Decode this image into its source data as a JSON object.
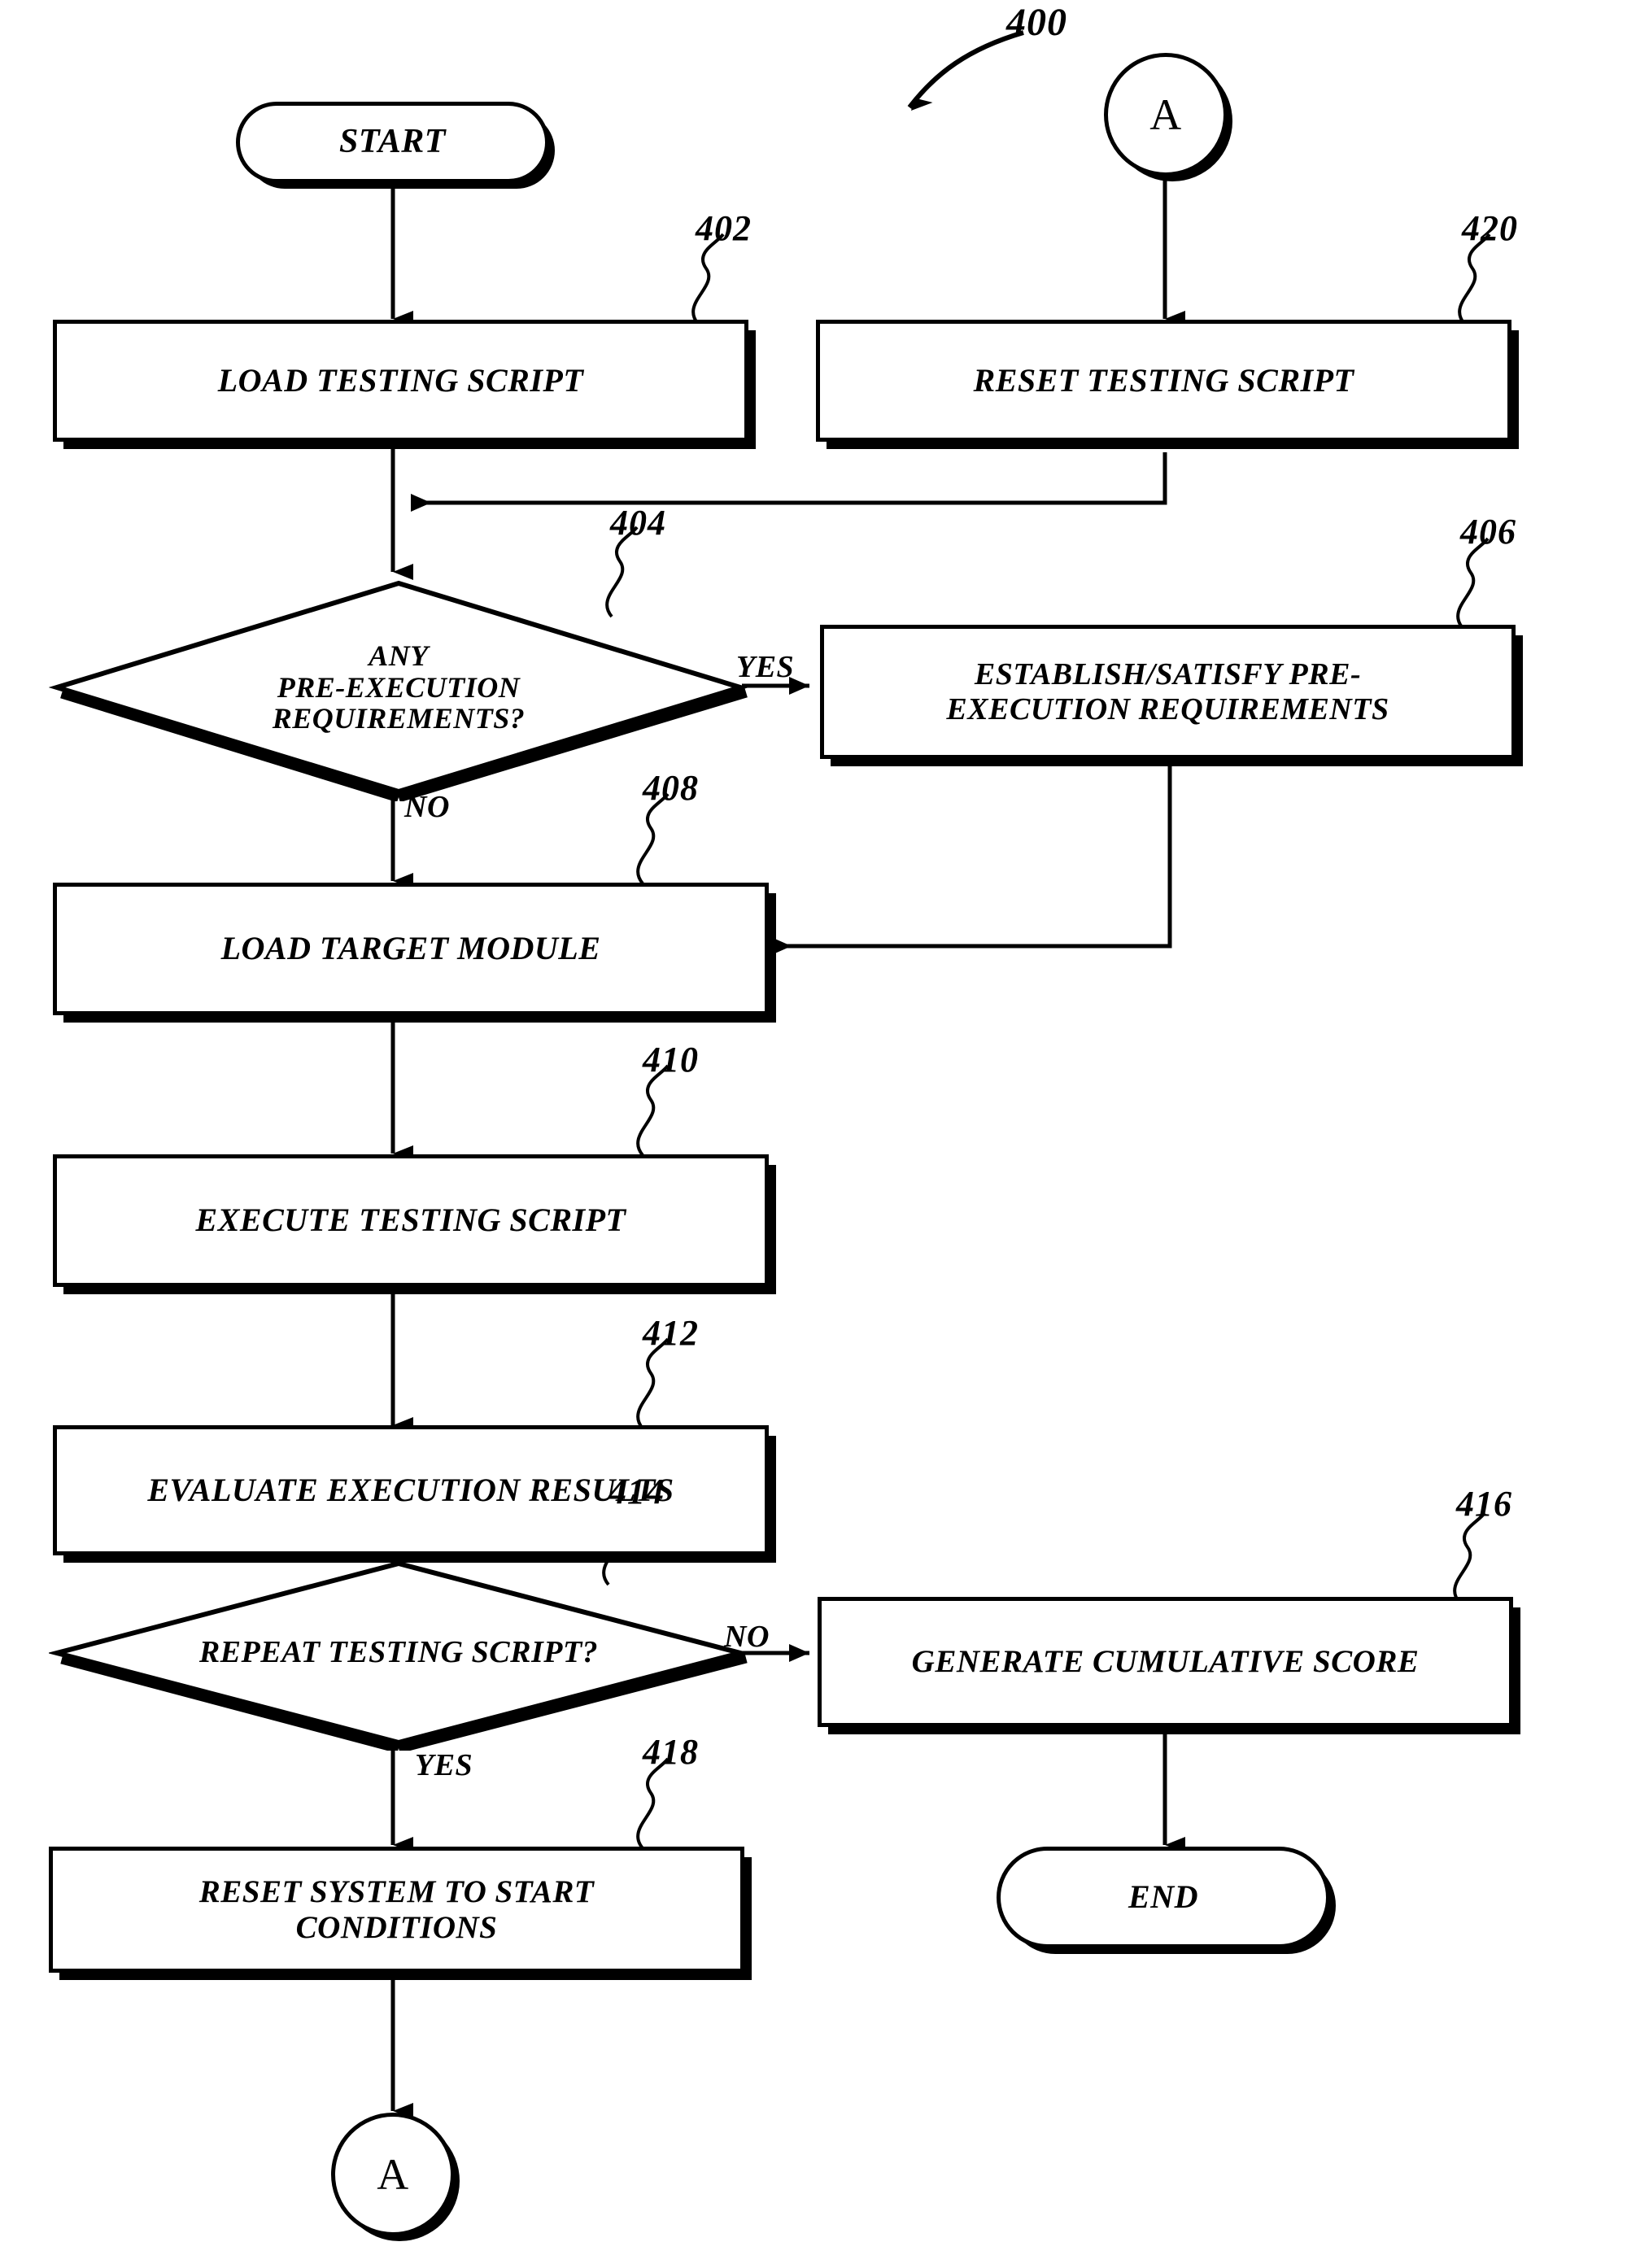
{
  "figure": {
    "reference_numeral": "400"
  },
  "nodes": {
    "start": {
      "label": "START",
      "ref": ""
    },
    "connector_a_top": {
      "label": "A"
    },
    "connector_a_bottom": {
      "label": "A"
    },
    "load_testing_script": {
      "label": "LOAD TESTING SCRIPT",
      "ref": "402"
    },
    "reset_testing_script": {
      "label": "RESET TESTING SCRIPT",
      "ref": "420"
    },
    "any_pre_execution_requirements": {
      "label": "ANY\nPRE-EXECUTION\nREQUIREMENTS?",
      "ref": "404"
    },
    "establish_satisfy": {
      "label": "ESTABLISH/SATISFY PRE-\nEXECUTION REQUIREMENTS",
      "ref": "406"
    },
    "load_target_module": {
      "label": "LOAD TARGET MODULE",
      "ref": "408"
    },
    "execute_testing_script": {
      "label": "EXECUTE TESTING SCRIPT",
      "ref": "410"
    },
    "evaluate_execution_results": {
      "label": "EVALUATE EXECUTION RESULTS",
      "ref": "412"
    },
    "repeat_testing_script": {
      "label": "REPEAT TESTING SCRIPT?",
      "ref": "414"
    },
    "generate_cumulative_score": {
      "label": "GENERATE CUMULATIVE SCORE",
      "ref": "416"
    },
    "reset_system_to_start": {
      "label": "RESET SYSTEM TO START\nCONDITIONS",
      "ref": "418"
    },
    "end": {
      "label": "END"
    }
  },
  "edge_labels": {
    "pre_execution_yes": "YES",
    "pre_execution_no": "NO",
    "repeat_no": "NO",
    "repeat_yes": "YES"
  },
  "colors": {
    "stroke": "#000000",
    "fill": "#ffffff",
    "text": "#000000"
  }
}
